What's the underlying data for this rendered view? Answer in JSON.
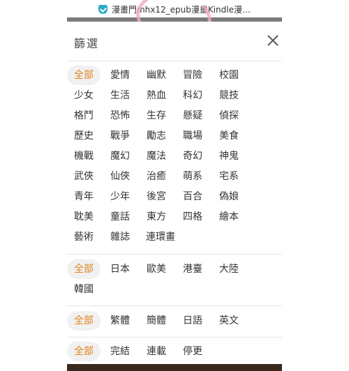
{
  "browser": {
    "url": "漫畫門mhx12_epub漫畫Kindle漫…"
  },
  "panel": {
    "title": "篩選"
  },
  "groups": [
    {
      "items": [
        "全部",
        "愛情",
        "幽默",
        "冒險",
        "校園",
        "少女",
        "生活",
        "熱血",
        "科幻",
        "競技",
        "格鬥",
        "恐怖",
        "生存",
        "懸疑",
        "偵探",
        "歷史",
        "戰爭",
        "勵志",
        "職場",
        "美食",
        "機戰",
        "魔幻",
        "魔法",
        "奇幻",
        "神鬼",
        "武俠",
        "仙俠",
        "治癒",
        "萌系",
        "宅系",
        "青年",
        "少年",
        "後宮",
        "百合",
        "偽娘",
        "耽美",
        "童話",
        "東方",
        "四格",
        "繪本",
        "藝術",
        "雜誌",
        "連環畫"
      ]
    },
    {
      "items": [
        "全部",
        "日本",
        "歐美",
        "港臺",
        "大陸",
        "韓國"
      ]
    },
    {
      "items": [
        "全部",
        "繁體",
        "簡體",
        "日語",
        "英文"
      ]
    },
    {
      "items": [
        "全部",
        "完結",
        "連載",
        "停更"
      ]
    }
  ],
  "colors": {
    "accent": "#e0841a",
    "chip_bg": "#f1f1f1"
  }
}
